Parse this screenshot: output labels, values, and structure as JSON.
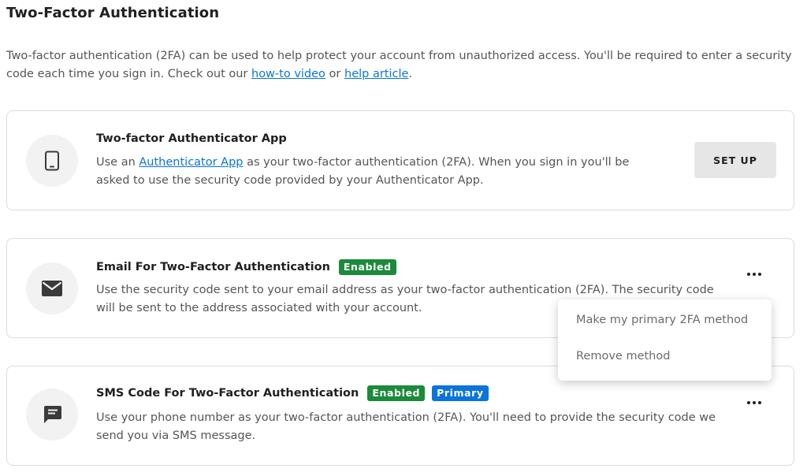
{
  "page": {
    "title": "Two-Factor Authentication",
    "intro_text": "Two-factor authentication (2FA) can be used to help protect your account from unauthorized access. You'll be required to enter a security code each time you sign in. Check out our ",
    "intro_link_video": "how-to video",
    "intro_or": " or ",
    "intro_link_article": "help article",
    "intro_end": "."
  },
  "app_method": {
    "icon": "tablet-icon",
    "title": "Two-factor Authenticator App",
    "desc_pre": "Use an ",
    "desc_link": "Authenticator App",
    "desc_post": " as your two-factor authentication (2FA). When you sign in you'll be asked to use the security code provided by your Authenticator App.",
    "setup_label": "SET UP"
  },
  "email_method": {
    "icon": "envelope-icon",
    "title": "Email For Two-Factor Authentication",
    "badge_enabled": "Enabled",
    "desc": "Use the security code sent to your email address as your two-factor authentication (2FA). The security code will be sent to the address associated with your account."
  },
  "sms_method": {
    "icon": "chat-message-icon",
    "title": "SMS Code For Two-Factor Authentication",
    "badge_enabled": "Enabled",
    "badge_primary": "Primary",
    "desc": "Use your phone number as your two-factor authentication (2FA). You'll need to provide the security code we send you via SMS message."
  },
  "dropdown_menu": {
    "items": [
      "Make my primary 2FA method",
      "Remove method"
    ]
  },
  "colors": {
    "link": "#0a74da",
    "enabled_badge": "#1b8a3b",
    "primary_badge": "#0a74da"
  }
}
